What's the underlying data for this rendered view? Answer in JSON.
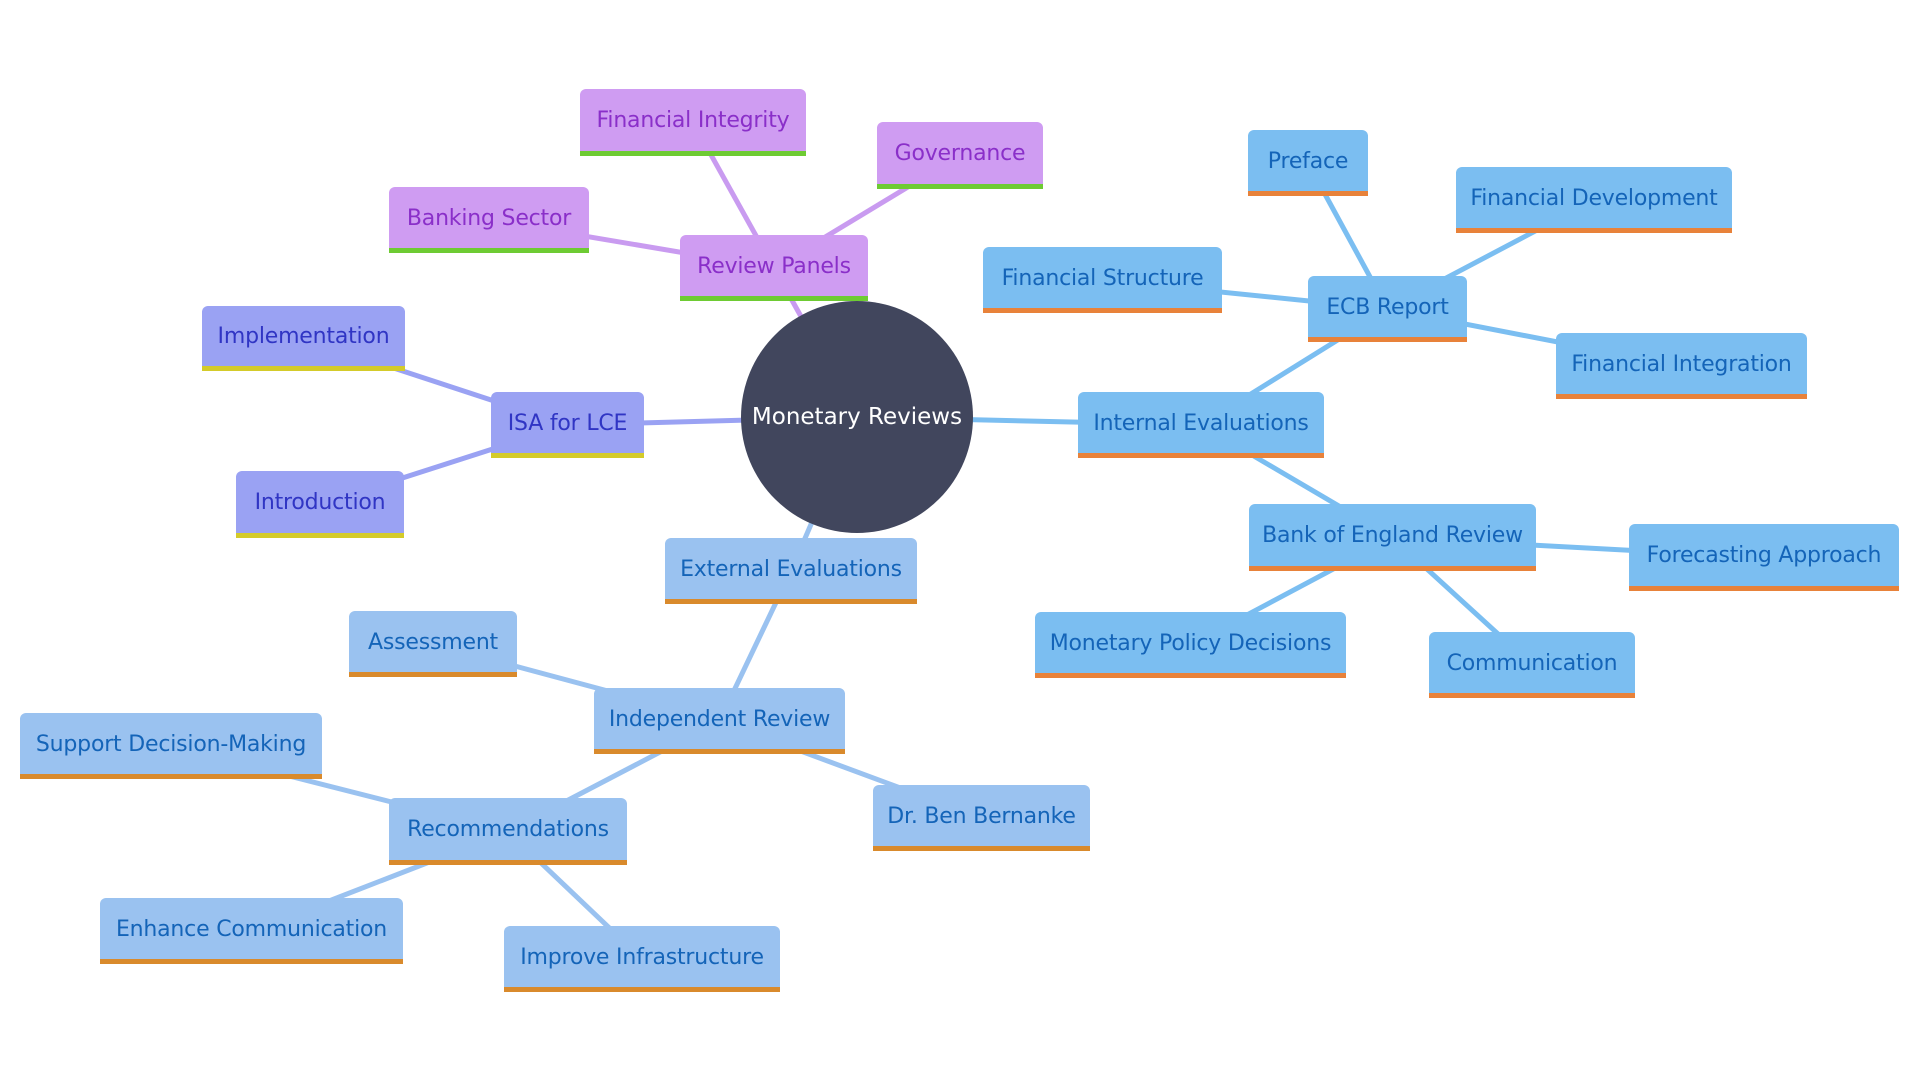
{
  "diagram": {
    "type": "mindmap",
    "root": {
      "id": "root",
      "label": "Monetary Reviews"
    },
    "colors": {
      "root_fill": "#41465d",
      "panels": {
        "fill": "#cf9cf2",
        "text": "#8a2fc9",
        "underline": "#6ecb33",
        "edge": "#c99bf0"
      },
      "isa": {
        "fill": "#9aa2f3",
        "text": "#3035c4",
        "underline": "#d4cb2a",
        "edge": "#9aa2f3"
      },
      "internal": {
        "fill": "#7bbef1",
        "text": "#1464b8",
        "underline": "#e8823a",
        "edge": "#7bbef1"
      },
      "external": {
        "fill": "#9ac2f0",
        "text": "#1464b8",
        "underline": "#d98a2c",
        "edge": "#9ac2f0"
      }
    },
    "nodes": [
      {
        "id": "review-panels",
        "label": "Review Panels",
        "parent": "root",
        "group": "panels"
      },
      {
        "id": "financial-integrity",
        "label": "Financial Integrity",
        "parent": "review-panels",
        "group": "panels"
      },
      {
        "id": "governance",
        "label": "Governance",
        "parent": "review-panels",
        "group": "panels"
      },
      {
        "id": "banking-sector",
        "label": "Banking Sector",
        "parent": "review-panels",
        "group": "panels"
      },
      {
        "id": "isa-for-lce",
        "label": "ISA for LCE",
        "parent": "root",
        "group": "isa"
      },
      {
        "id": "implementation",
        "label": "Implementation",
        "parent": "isa-for-lce",
        "group": "isa"
      },
      {
        "id": "introduction",
        "label": "Introduction",
        "parent": "isa-for-lce",
        "group": "isa"
      },
      {
        "id": "internal-evaluations",
        "label": "Internal Evaluations",
        "parent": "root",
        "group": "internal"
      },
      {
        "id": "ecb-report",
        "label": "ECB Report",
        "parent": "internal-evaluations",
        "group": "internal"
      },
      {
        "id": "preface",
        "label": "Preface",
        "parent": "ecb-report",
        "group": "internal"
      },
      {
        "id": "financial-development",
        "label": "Financial Development",
        "parent": "ecb-report",
        "group": "internal"
      },
      {
        "id": "financial-structure",
        "label": "Financial Structure",
        "parent": "ecb-report",
        "group": "internal"
      },
      {
        "id": "financial-integration",
        "label": "Financial Integration",
        "parent": "ecb-report",
        "group": "internal"
      },
      {
        "id": "bank-of-england-review",
        "label": "Bank of England Review",
        "parent": "internal-evaluations",
        "group": "internal"
      },
      {
        "id": "forecasting-approach",
        "label": "Forecasting Approach",
        "parent": "bank-of-england-review",
        "group": "internal"
      },
      {
        "id": "monetary-policy-decisions",
        "label": "Monetary Policy Decisions",
        "parent": "bank-of-england-review",
        "group": "internal"
      },
      {
        "id": "communication",
        "label": "Communication",
        "parent": "bank-of-england-review",
        "group": "internal"
      },
      {
        "id": "external-evaluations",
        "label": "External Evaluations",
        "parent": "root",
        "group": "external"
      },
      {
        "id": "independent-review",
        "label": "Independent Review",
        "parent": "external-evaluations",
        "group": "external"
      },
      {
        "id": "assessment",
        "label": "Assessment",
        "parent": "independent-review",
        "group": "external"
      },
      {
        "id": "dr-ben-bernanke",
        "label": "Dr. Ben Bernanke",
        "parent": "independent-review",
        "group": "external"
      },
      {
        "id": "recommendations",
        "label": "Recommendations",
        "parent": "independent-review",
        "group": "external"
      },
      {
        "id": "support-decision-making",
        "label": "Support Decision-Making",
        "parent": "recommendations",
        "group": "external"
      },
      {
        "id": "enhance-communication",
        "label": "Enhance Communication",
        "parent": "recommendations",
        "group": "external"
      },
      {
        "id": "improve-infrastructure",
        "label": "Improve Infrastructure",
        "parent": "recommendations",
        "group": "external"
      }
    ]
  }
}
